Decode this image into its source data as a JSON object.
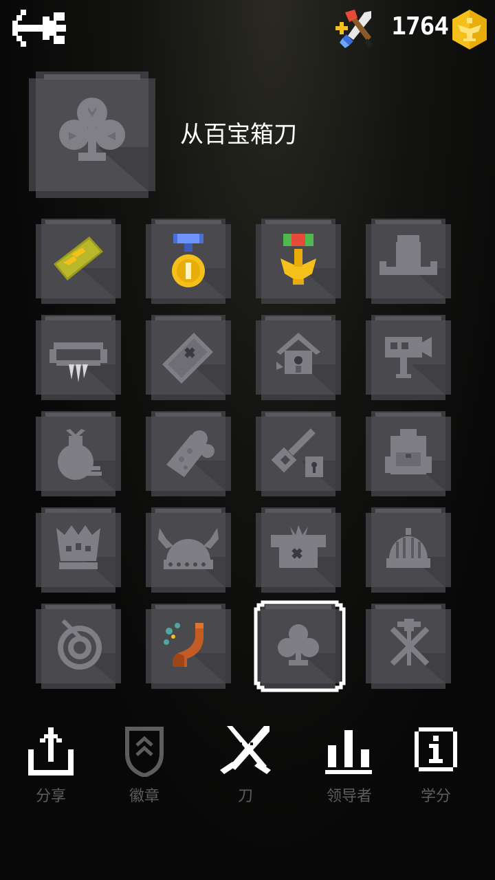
{
  "header": {
    "coins": "1764"
  },
  "hero": {
    "title": "从百宝箱刀"
  },
  "colors": {
    "tile_face": "#4a4a4e",
    "tile_edge": "#2f2f33",
    "tile_light": "#5a5a5f",
    "locked_icon": "#7e7e84",
    "gold": "#f5c01a",
    "nav_label": "#5d5d5d"
  },
  "items": [
    {
      "name": "sergeant-ticket",
      "state": "unlocked"
    },
    {
      "name": "gold-medal",
      "state": "unlocked"
    },
    {
      "name": "eagle-medal",
      "state": "unlocked"
    },
    {
      "name": "witch-hat",
      "state": "locked"
    },
    {
      "name": "bone-necklace",
      "state": "locked"
    },
    {
      "name": "treasure-map",
      "state": "locked"
    },
    {
      "name": "birdhouse",
      "state": "locked"
    },
    {
      "name": "video-camera",
      "state": "locked"
    },
    {
      "name": "money-bag",
      "state": "locked"
    },
    {
      "name": "cheese-roll",
      "state": "locked"
    },
    {
      "name": "key-lock",
      "state": "locked"
    },
    {
      "name": "backpack",
      "state": "locked"
    },
    {
      "name": "crown",
      "state": "locked"
    },
    {
      "name": "viking-helmet",
      "state": "locked"
    },
    {
      "name": "shop-stall",
      "state": "locked"
    },
    {
      "name": "hedgehog-helmet",
      "state": "locked"
    },
    {
      "name": "target-dart",
      "state": "locked"
    },
    {
      "name": "smoking-pipe",
      "state": "unlocked"
    },
    {
      "name": "club-suit",
      "state": "selected"
    },
    {
      "name": "crossed-swords-axe",
      "state": "locked"
    }
  ],
  "nav": [
    {
      "label": "分享",
      "icon": "share-icon"
    },
    {
      "label": "徽章",
      "icon": "badge-icon"
    },
    {
      "label": "刀",
      "icon": "knives-icon"
    },
    {
      "label": "领导者",
      "icon": "leaderboard-icon"
    },
    {
      "label": "学分",
      "icon": "info-icon"
    }
  ]
}
